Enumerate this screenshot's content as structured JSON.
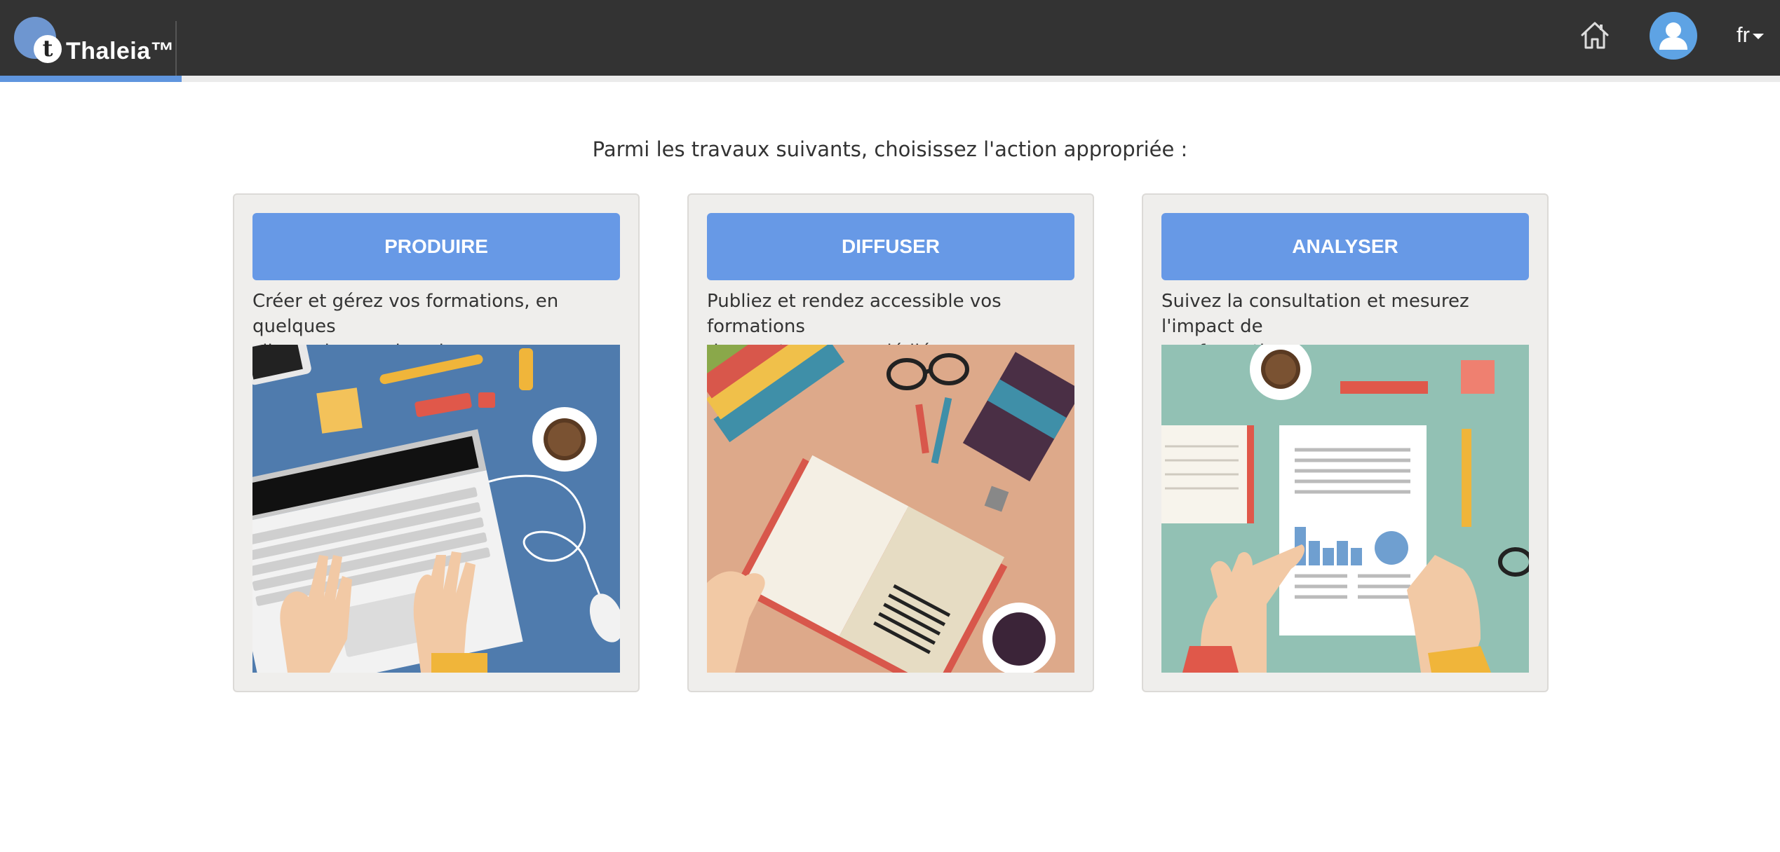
{
  "header": {
    "brand": "Thaleia™",
    "brand_initial": "t",
    "language": "fr",
    "icons": [
      "home-icon",
      "user-icon",
      "caret-down-icon"
    ],
    "colors": {
      "bar": "#333333",
      "accent": "#5f95de",
      "avatar": "#5ea3e4"
    }
  },
  "progress": {
    "fraction": 0.102
  },
  "main": {
    "prompt": "Parmi les travaux suivants, choisissez l'action appropriée :",
    "cards": [
      {
        "button": "PRODUIRE",
        "desc_line1": "Créer et gérez vos formations, en quelques",
        "desc_line2": "clics, selon vos besoins.",
        "illustration": "laptop-desk-illustration",
        "bg_color": "#4f7bad"
      },
      {
        "button": "DIFFUSER",
        "desc_line1": "Publiez et rendez accessible vos formations",
        "desc_line2": "dans votre espace dédié.",
        "illustration": "books-desk-illustration",
        "bg_color": "#dda98a"
      },
      {
        "button": "ANALYSER",
        "desc_line1": "Suivez la consultation et mesurez l'impact de",
        "desc_line2": "vos formations.",
        "illustration": "report-desk-illustration",
        "bg_color": "#92c1b4"
      }
    ],
    "button_color": "#6799e6"
  }
}
